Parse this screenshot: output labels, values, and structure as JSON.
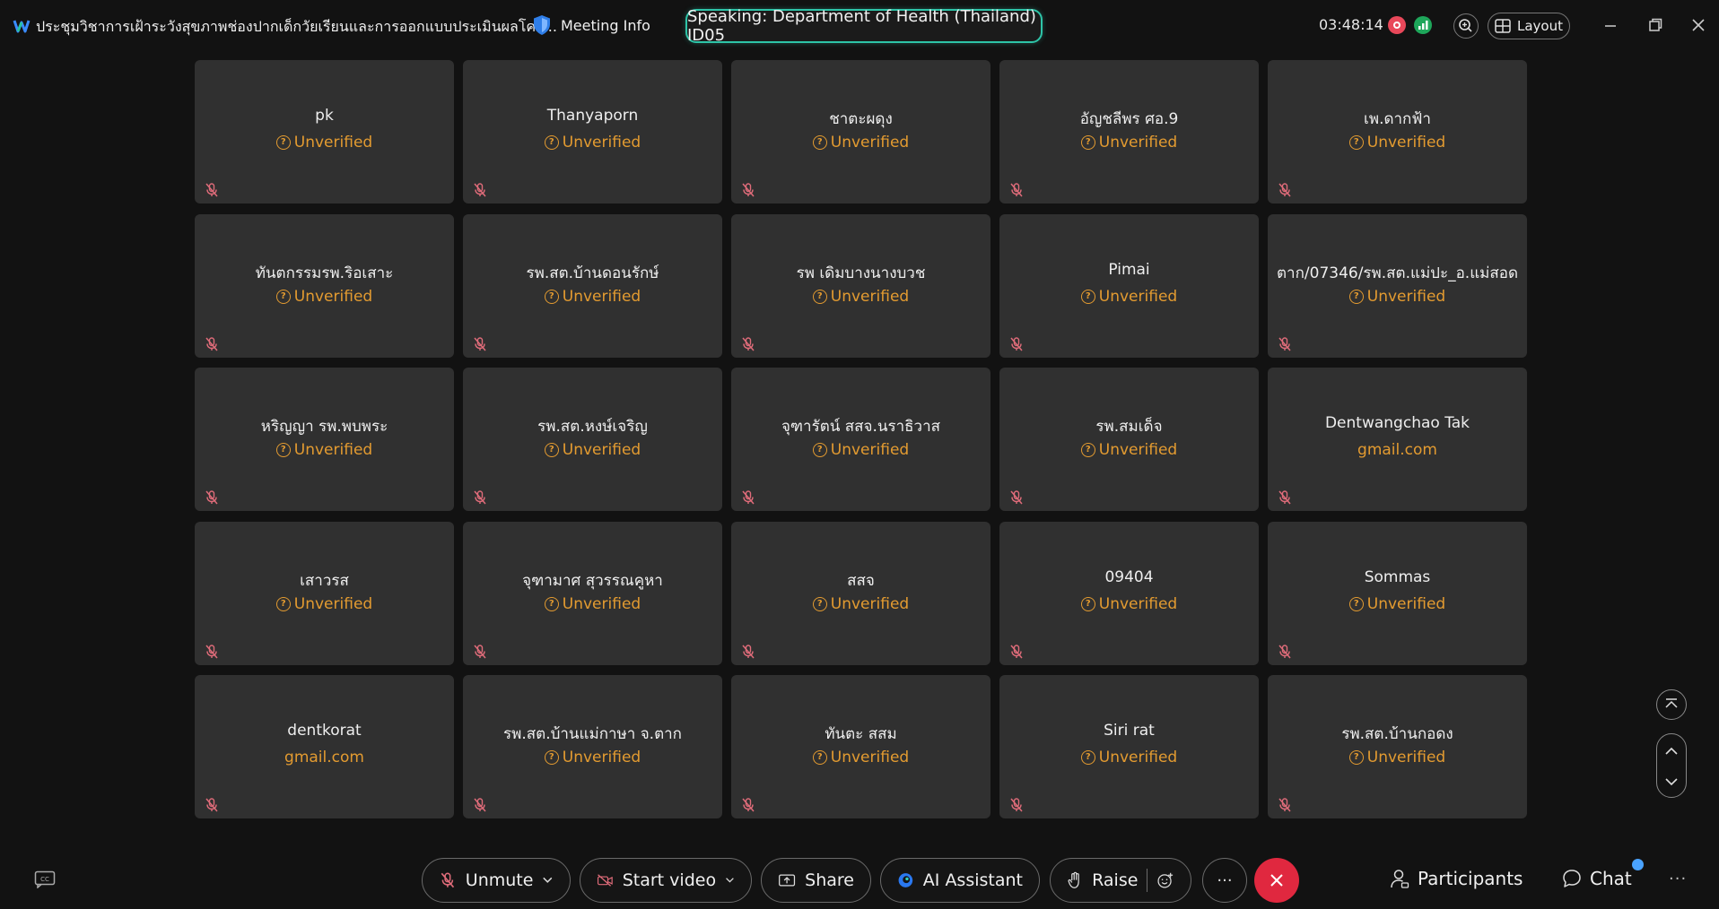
{
  "topbar": {
    "meeting_title": "ประชุมวิชาการเฝ้าระวังสุขภาพช่องปากเด็กวัยเรียนและการออกแบบประเมินผลโคร...",
    "meeting_info_label": "Meeting Info",
    "speaking": "Speaking: Department of Health (Thailand) ID05",
    "timer": "03:48:14",
    "layout_label": "Layout"
  },
  "colors": {
    "accent_teal": "#2ec4a8",
    "unverified": "#e39b30",
    "end_call": "#e0283f",
    "recording": "#e9485a",
    "signal": "#1ea65a",
    "chat_badge": "#4aa3ff"
  },
  "participants": [
    {
      "name": "pk",
      "status": "Unverified",
      "icon": true
    },
    {
      "name": "Thanyaporn",
      "status": "Unverified",
      "icon": true
    },
    {
      "name": "ชาตะผดุง",
      "status": "Unverified",
      "icon": true
    },
    {
      "name": "อัญชลีพร ศอ.9",
      "status": "Unverified",
      "icon": true
    },
    {
      "name": "เพ.ดากฟ้า",
      "status": "Unverified",
      "icon": true
    },
    {
      "name": "ทันตกรรมรพ.ริอเสาะ",
      "status": "Unverified",
      "icon": true
    },
    {
      "name": "รพ.สต.บ้านดอนรักษ์",
      "status": "Unverified",
      "icon": true
    },
    {
      "name": "รพ  เดิมบางนางบวช",
      "status": "Unverified",
      "icon": true
    },
    {
      "name": "Pimai",
      "status": "Unverified",
      "icon": true
    },
    {
      "name": "ตาก/07346/รพ.สต.แม่ปะ_อ.แม่สอด",
      "status": "Unverified",
      "icon": true
    },
    {
      "name": "หริญญา รพ.พบพระ",
      "status": "Unverified",
      "icon": true
    },
    {
      "name": "รพ.สต.หงษ์เจริญ",
      "status": "Unverified",
      "icon": true
    },
    {
      "name": "จุฑารัตน์ สสจ.นราธิวาส",
      "status": "Unverified",
      "icon": true
    },
    {
      "name": "รพ.สมเด็จ",
      "status": "Unverified",
      "icon": true
    },
    {
      "name": "Dentwangchao Tak",
      "status": "gmail.com",
      "icon": false
    },
    {
      "name": "เสาวรส",
      "status": "Unverified",
      "icon": true
    },
    {
      "name": "จุฑามาศ สุวรรณคูหา",
      "status": "Unverified",
      "icon": true
    },
    {
      "name": "สสจ",
      "status": "Unverified",
      "icon": true
    },
    {
      "name": "09404",
      "status": "Unverified",
      "icon": true
    },
    {
      "name": "Sommas",
      "status": "Unverified",
      "icon": true
    },
    {
      "name": "dentkorat",
      "status": "gmail.com",
      "icon": false
    },
    {
      "name": "รพ.สต.บ้านแม่กาษา จ.ตาก",
      "status": "Unverified",
      "icon": true
    },
    {
      "name": "ทันตะ สสม",
      "status": "Unverified",
      "icon": true
    },
    {
      "name": "Siri rat",
      "status": "Unverified",
      "icon": true
    },
    {
      "name": "รพ.สต.บ้านกอดง",
      "status": "Unverified",
      "icon": true
    }
  ],
  "bottombar": {
    "unmute_label": "Unmute",
    "start_video_label": "Start video",
    "share_label": "Share",
    "ai_label": "AI Assistant",
    "raise_label": "Raise",
    "participants_label": "Participants",
    "chat_label": "Chat"
  }
}
